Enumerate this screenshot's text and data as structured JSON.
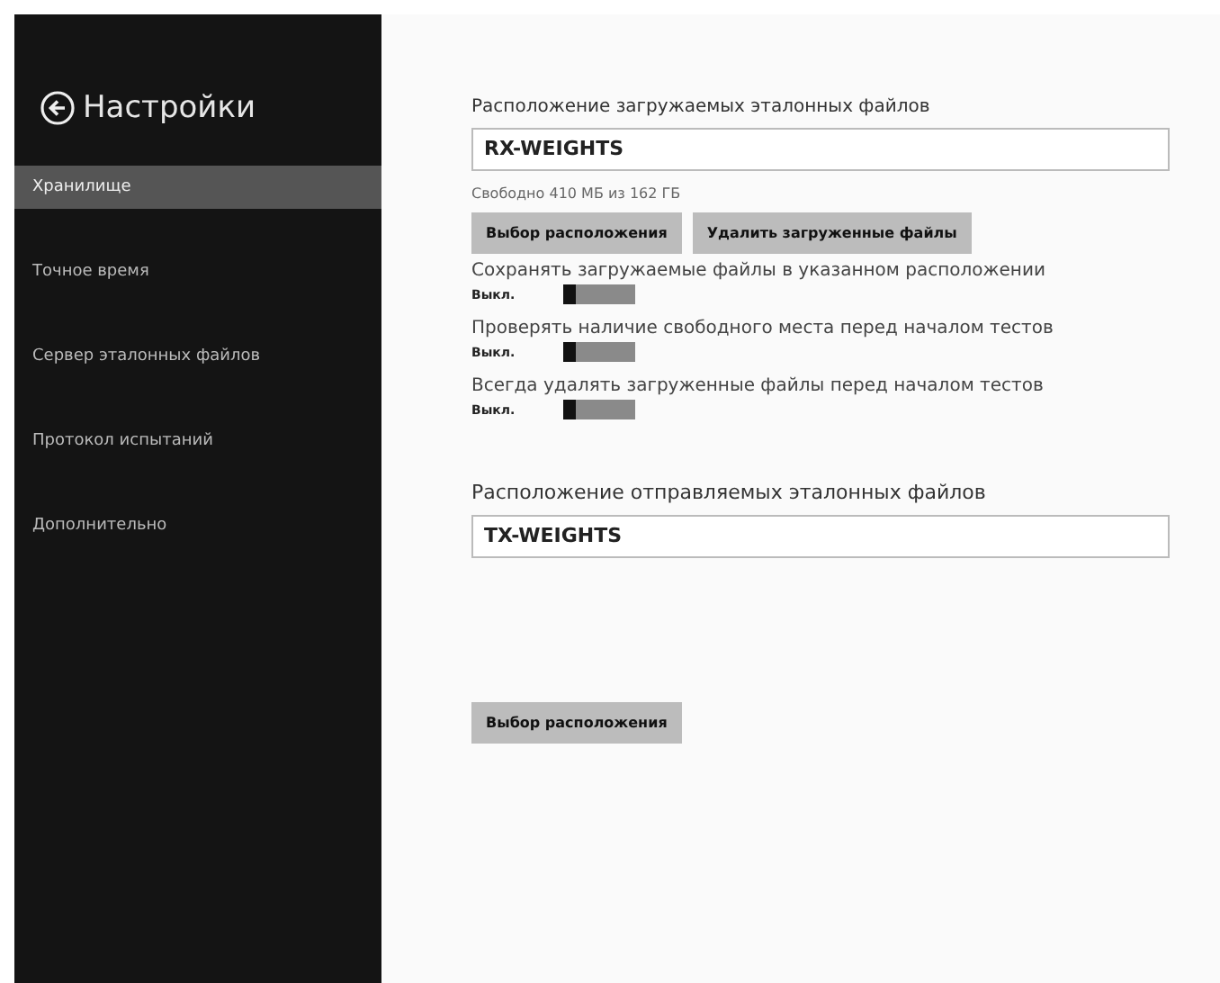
{
  "sidebar": {
    "title": "Настройки",
    "items": [
      {
        "label": "Хранилище",
        "selected": true
      },
      {
        "label": "Точное время",
        "selected": false
      },
      {
        "label": "Сервер эталонных файлов",
        "selected": false
      },
      {
        "label": "Протокол испытаний",
        "selected": false
      },
      {
        "label": "Дополнительно",
        "selected": false
      }
    ]
  },
  "download": {
    "heading": "Расположение загружаемых эталонных файлов",
    "value": "RX-WEIGHTS",
    "free_space": "Свободно 410 МБ из 162 ГБ",
    "buttons": [
      "Выбор расположения",
      "Удалить загруженные файлы"
    ]
  },
  "toggles": [
    {
      "label": "Сохранять загружаемые файлы в указанном расположении",
      "state_text": "Выкл.",
      "on": false
    },
    {
      "label": "Проверять наличие свободного места перед началом тестов",
      "state_text": "Выкл.",
      "on": false
    },
    {
      "label": "Всегда удалять загруженные файлы перед началом тестов",
      "state_text": "Выкл.",
      "on": false
    }
  ],
  "upload": {
    "heading": "Расположение отправляемых эталонных файлов",
    "value": "TX-WEIGHTS",
    "button": "Выбор расположения"
  }
}
